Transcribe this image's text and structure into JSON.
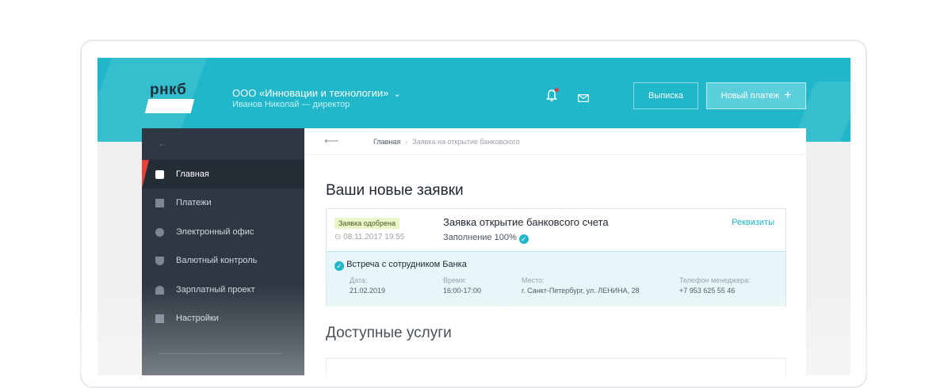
{
  "header": {
    "logo_text": "рнкб",
    "company_name": "ООО «Инновации и технологии»",
    "user_role": "Иванов Николай — директор",
    "statement_button": "Выписка",
    "new_payment_button": "Новый платеж",
    "brand_color": "#1fb7c9"
  },
  "sidebar": {
    "items": [
      {
        "label": "Главная",
        "icon": "home-icon",
        "active": true
      },
      {
        "label": "Платежи",
        "icon": "wallet-icon"
      },
      {
        "label": "Электронный офис",
        "icon": "office-icon"
      },
      {
        "label": "Валютный контроль",
        "icon": "shield-icon"
      },
      {
        "label": "Зарплатный проект",
        "icon": "user-icon"
      },
      {
        "label": "Настройки",
        "icon": "settings-icon"
      }
    ]
  },
  "breadcrumb": {
    "home": "Главная",
    "current": "Заявка на открытие банковского"
  },
  "main": {
    "requests_title": "Ваши новые заявки",
    "request": {
      "status": "Заявка одобрена",
      "datetime": "08.11.2017 19:55",
      "title": "Заявка открытие банковсого счета",
      "progress": "Заполнение 100%",
      "details_link": "Реквизиты"
    },
    "meeting": {
      "title": "Встреча с сотрудником Банка",
      "date_label": "Дата:",
      "date_value": "21.02.2019",
      "time_label": "Время:",
      "time_value": "16:00-17:00",
      "place_label": "Место:",
      "place_value": "г. Санкт-Петербург, ул. ЛЕНИНА, 28",
      "phone_label": "Телефон менеджера:",
      "phone_value": "+7 953 625 55 46"
    },
    "services_title": "Доступные услуги"
  }
}
